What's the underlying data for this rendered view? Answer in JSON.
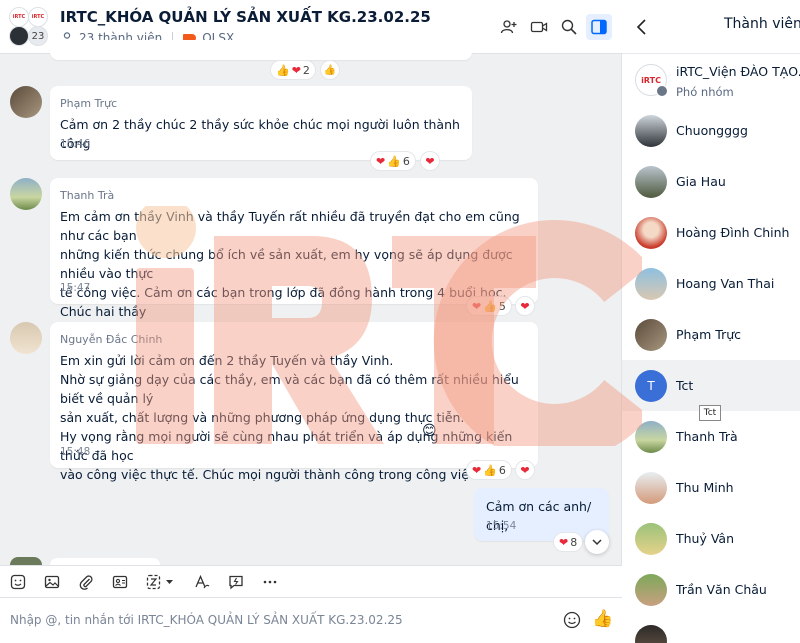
{
  "header": {
    "title": "IRTC_KHÓA QUẢN LÝ SẢN XUẤT KG.23.02.25",
    "member_count": "23 thành viên",
    "label_tag": "QLSX",
    "avatar_count": "23"
  },
  "top_reaction": {
    "count": "2"
  },
  "messages": [
    {
      "sender": "Phạm Trực",
      "text": "Cảm ơn 2 thầy chúc 2 thầy sức khỏe chúc mọi người luôn thành công",
      "time": "15:46",
      "reaction_count": "6"
    },
    {
      "sender": "Thanh Trà",
      "text": "Em cảm ơn thầy Vinh và thầy Tuyến rất nhiều đã truyền đạt cho em cũng như các bạn\nnhững kiến thức chung bổ ích về sản xuất, em hy vọng sẽ áp dụng được nhiều vào thực\ntế công việc. Cảm ơn các bạn trong lớp đã đồng hành trong 4 buổi học. Chúc hai thầy\nvà các bạn nhiều sức khỏe và thành công!",
      "time": "15:47",
      "reaction_count": "5"
    },
    {
      "sender": "Nguyễn Đắc Chinh",
      "text": "Em xin gửi lời cảm ơn đến 2 thầy Tuyến và thầy Vinh.\nNhờ sự giảng dạy của các thầy, em và các bạn đã có thêm rất nhiều hiểu biết về quản lý\nsản xuất, chất lượng và những phương pháp ứng dụng thực tiễn.\nHy vọng rằng mọi người sẽ cùng nhau phát triển và áp dụng những kiến thức đã học\nvào công việc thực tế. Chúc mọi người thành công trong công việc",
      "time": "15:48",
      "reaction_count": "6"
    }
  ],
  "my_message": {
    "text": "Cảm ơn các anh/ chị,",
    "time": "15:54",
    "reaction_count": "8"
  },
  "input": {
    "placeholder": "Nhập @, tin nhắn tới IRTC_KHÓA QUẢN LÝ SẢN XUẤT KG.23.02.25"
  },
  "members_panel": {
    "title": "Thành viên",
    "members": [
      {
        "name": "iRTC_Viện ĐÀO TẠO.h",
        "role": "Phó nhóm"
      },
      {
        "name": "Chuongggg"
      },
      {
        "name": "Gia Hau"
      },
      {
        "name": "Hoàng Đình Chinh"
      },
      {
        "name": "Hoang Van Thai"
      },
      {
        "name": "Phạm Trực"
      },
      {
        "name": "Tct",
        "initial": "T"
      },
      {
        "name": "Thanh Trà"
      },
      {
        "name": "Thu Minh"
      },
      {
        "name": "Thuỷ Vân"
      },
      {
        "name": "Trần Văn Châu"
      }
    ],
    "tooltip": "Tct"
  },
  "watermark": "iRTC",
  "colors": {
    "accent": "#0068ff",
    "tag": "#f25a1c",
    "heart": "#e8293a",
    "watermark": "#f3b8a8"
  },
  "icons": [
    "add-member-icon",
    "video-call-icon",
    "search-icon",
    "panel-toggle-icon",
    "sticker-icon",
    "image-icon",
    "attach-icon",
    "contact-card-icon",
    "screenshot-icon",
    "format-text-icon",
    "quick-message-icon",
    "more-icon",
    "emoji-icon",
    "like-icon",
    "back-icon"
  ]
}
